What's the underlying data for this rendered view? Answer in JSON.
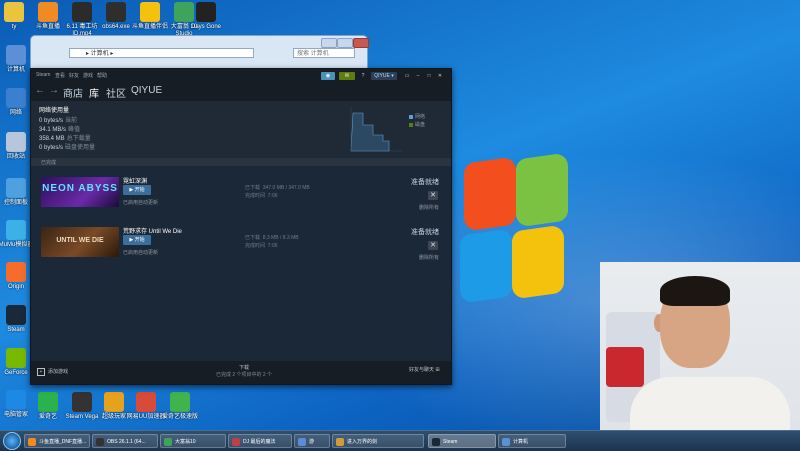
{
  "desktop": {
    "top_icons": [
      {
        "label": "ty",
        "color": "#e9c43c"
      },
      {
        "label": "斗鱼直播",
        "color": "#f08a24"
      },
      {
        "label": "6.11 毒工坊 ID.mp4",
        "color": "#2b2b2b"
      },
      {
        "label": "obs64.exe",
        "color": "#2e2e2e"
      },
      {
        "label": "斗鱼直播伴侣",
        "color": "#f4c20d"
      },
      {
        "label": "大富翁 10 Studio",
        "color": "#3da35d"
      },
      {
        "label": "Days Gone",
        "color": "#222222"
      }
    ],
    "left_icons": [
      {
        "label": "计算机",
        "color": "#5b8fd6"
      },
      {
        "label": "网络",
        "color": "#3a7fd0"
      },
      {
        "label": "回收站",
        "color": "#b6c7dd"
      },
      {
        "label": "控制面板",
        "color": "#4fa0e0"
      },
      {
        "label": "MuMu模拟器",
        "color": "#3ab2e8"
      },
      {
        "label": "Origin",
        "color": "#f56c2d"
      },
      {
        "label": "Steam",
        "color": "#1b2838"
      },
      {
        "label": "GeForce",
        "color": "#76b900"
      },
      {
        "label": "电脑管家",
        "color": "#1e88e5"
      }
    ],
    "bottom_icons": [
      {
        "label": "爱奇艺",
        "color": "#2bb24c"
      },
      {
        "label": "Steam Vega",
        "color": "#333333"
      },
      {
        "label": "超级玩家",
        "color": "#e6a21c"
      },
      {
        "label": "网易UU加速器",
        "color": "#d84a3a"
      },
      {
        "label": "爱奇艺极速版",
        "color": "#40b34f"
      }
    ]
  },
  "explorer": {
    "address": "▸ 计算机 ▸",
    "search": "搜索 计算机"
  },
  "steam": {
    "menu": [
      "Steam",
      "查看",
      "好友",
      "游戏",
      "帮助"
    ],
    "user": "QIYUE ▾",
    "nav": {
      "store": "商店",
      "library": "库",
      "community": "社区",
      "user": "QIYUE"
    },
    "network": {
      "title": "网络使用量",
      "lines": [
        {
          "value": "0 bytes/s",
          "label": "当前"
        },
        {
          "value": "34.1 MB/s",
          "label": "峰值"
        },
        {
          "value": "358.4 MB",
          "label": "总下载量"
        },
        {
          "value": "0 bytes/s",
          "label": "磁盘使用量"
        }
      ],
      "legend": [
        "网络",
        "磁盘"
      ]
    },
    "section": "已完成",
    "games": [
      {
        "title": "霓虹深渊",
        "play": "▶ 开始",
        "date": "已启用自动更新",
        "dl_label": "已下载",
        "dl_value": "347.0 MB / 347.0 MB",
        "time_label": "完成时间",
        "time_value": "7:06",
        "status": "准备就绪",
        "remove": "删除所有",
        "thumb_text": "NEON ABYSS",
        "thumb_color": "#3a1a6e"
      },
      {
        "title": "荒野求存 Until We Die",
        "play": "▶ 开始",
        "date": "已启用自动更新",
        "dl_label": "已下载",
        "dl_value": "8.3 MB / 8.3 MB",
        "time_label": "完成时间",
        "time_value": "7:06",
        "status": "准备就绪",
        "remove": "删除所有",
        "thumb_text": "UNTIL WE DIE",
        "thumb_color": "#5a3a22"
      }
    ],
    "footer": {
      "add_game": "添加游戏",
      "downloads": "下载",
      "downloads_sub": "已完成 2 个项目中的 2 个",
      "friends": "好友与聊天"
    }
  },
  "taskbar": {
    "items": [
      {
        "label": "斗鱼直播_DNF直播...",
        "color": "#f08a24"
      },
      {
        "label": "OBS 26.1.1 (64...",
        "color": "#333333"
      },
      {
        "label": "大富翁10",
        "color": "#3da35d"
      },
      {
        "label": "DJ 最后的魔法",
        "color": "#b94242"
      },
      {
        "label": "游",
        "color": "#5a8dd6"
      },
      {
        "label": "进入万界的剑",
        "color": "#d19a3a"
      },
      {
        "label": "Steam",
        "color": "#1b2838"
      },
      {
        "label": "计算机",
        "color": "#5b8fd6"
      }
    ]
  }
}
